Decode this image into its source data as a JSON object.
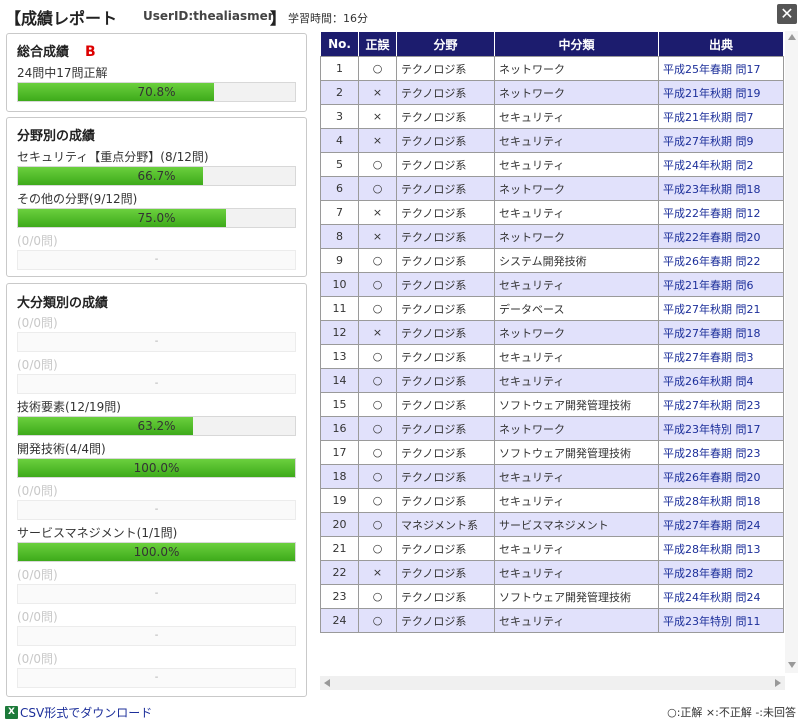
{
  "header": {
    "title": "【成績レポート",
    "user_id": "UserID:thealiasmen",
    "bracket_close": "】",
    "study_time": "学習時間：16分",
    "close_glyph": "✕"
  },
  "overall": {
    "heading": "総合成績",
    "grade": "B",
    "summary": "24問中17問正解",
    "percent": 70.8,
    "percent_label": "70.8%"
  },
  "field": {
    "heading": "分野別の成績",
    "items": [
      {
        "label": "セキュリティ【重点分野】(8/12問)",
        "percent": 66.7,
        "percent_label": "66.7%",
        "empty": false
      },
      {
        "label": "その他の分野(9/12問)",
        "percent": 75.0,
        "percent_label": "75.0%",
        "empty": false
      },
      {
        "label": "(0/0問)",
        "percent": 0,
        "percent_label": "-",
        "empty": true
      }
    ]
  },
  "major": {
    "heading": "大分類別の成績",
    "items": [
      {
        "label": "(0/0問)",
        "percent": 0,
        "percent_label": "-",
        "empty": true
      },
      {
        "label": "(0/0問)",
        "percent": 0,
        "percent_label": "-",
        "empty": true
      },
      {
        "label": "技術要素(12/19問)",
        "percent": 63.2,
        "percent_label": "63.2%",
        "empty": false
      },
      {
        "label": "開発技術(4/4問)",
        "percent": 100.0,
        "percent_label": "100.0%",
        "empty": false
      },
      {
        "label": "(0/0問)",
        "percent": 0,
        "percent_label": "-",
        "empty": true
      },
      {
        "label": "サービスマネジメント(1/1問)",
        "percent": 100.0,
        "percent_label": "100.0%",
        "empty": false
      },
      {
        "label": "(0/0問)",
        "percent": 0,
        "percent_label": "-",
        "empty": true
      },
      {
        "label": "(0/0問)",
        "percent": 0,
        "percent_label": "-",
        "empty": true
      },
      {
        "label": "(0/0問)",
        "percent": 0,
        "percent_label": "-",
        "empty": true
      }
    ]
  },
  "table": {
    "headers": [
      "No.",
      "正誤",
      "分野",
      "中分類",
      "出典"
    ],
    "rows": [
      {
        "no": "1",
        "mark": "○",
        "field": "テクノロジ系",
        "category": "ネットワーク",
        "source": "平成25年春期 問17"
      },
      {
        "no": "2",
        "mark": "×",
        "field": "テクノロジ系",
        "category": "ネットワーク",
        "source": "平成21年秋期 問19"
      },
      {
        "no": "3",
        "mark": "×",
        "field": "テクノロジ系",
        "category": "セキュリティ",
        "source": "平成21年秋期 問7"
      },
      {
        "no": "4",
        "mark": "×",
        "field": "テクノロジ系",
        "category": "セキュリティ",
        "source": "平成27年秋期 問9"
      },
      {
        "no": "5",
        "mark": "○",
        "field": "テクノロジ系",
        "category": "セキュリティ",
        "source": "平成24年秋期 問2"
      },
      {
        "no": "6",
        "mark": "○",
        "field": "テクノロジ系",
        "category": "ネットワーク",
        "source": "平成23年秋期 問18"
      },
      {
        "no": "7",
        "mark": "×",
        "field": "テクノロジ系",
        "category": "セキュリティ",
        "source": "平成22年春期 問12"
      },
      {
        "no": "8",
        "mark": "×",
        "field": "テクノロジ系",
        "category": "ネットワーク",
        "source": "平成22年春期 問20"
      },
      {
        "no": "9",
        "mark": "○",
        "field": "テクノロジ系",
        "category": "システム開発技術",
        "source": "平成26年春期 問22"
      },
      {
        "no": "10",
        "mark": "○",
        "field": "テクノロジ系",
        "category": "セキュリティ",
        "source": "平成21年春期 問6"
      },
      {
        "no": "11",
        "mark": "○",
        "field": "テクノロジ系",
        "category": "データベース",
        "source": "平成27年秋期 問21"
      },
      {
        "no": "12",
        "mark": "×",
        "field": "テクノロジ系",
        "category": "ネットワーク",
        "source": "平成27年春期 問18"
      },
      {
        "no": "13",
        "mark": "○",
        "field": "テクノロジ系",
        "category": "セキュリティ",
        "source": "平成27年春期 問3"
      },
      {
        "no": "14",
        "mark": "○",
        "field": "テクノロジ系",
        "category": "セキュリティ",
        "source": "平成26年秋期 問4"
      },
      {
        "no": "15",
        "mark": "○",
        "field": "テクノロジ系",
        "category": "ソフトウェア開発管理技術",
        "source": "平成27年秋期 問23"
      },
      {
        "no": "16",
        "mark": "○",
        "field": "テクノロジ系",
        "category": "ネットワーク",
        "source": "平成23年特別 問17"
      },
      {
        "no": "17",
        "mark": "○",
        "field": "テクノロジ系",
        "category": "ソフトウェア開発管理技術",
        "source": "平成28年春期 問23"
      },
      {
        "no": "18",
        "mark": "○",
        "field": "テクノロジ系",
        "category": "セキュリティ",
        "source": "平成26年春期 問20"
      },
      {
        "no": "19",
        "mark": "○",
        "field": "テクノロジ系",
        "category": "セキュリティ",
        "source": "平成28年秋期 問18"
      },
      {
        "no": "20",
        "mark": "○",
        "field": "マネジメント系",
        "category": "サービスマネジメント",
        "source": "平成27年春期 問24"
      },
      {
        "no": "21",
        "mark": "○",
        "field": "テクノロジ系",
        "category": "セキュリティ",
        "source": "平成28年秋期 問13"
      },
      {
        "no": "22",
        "mark": "×",
        "field": "テクノロジ系",
        "category": "セキュリティ",
        "source": "平成28年春期 問2"
      },
      {
        "no": "23",
        "mark": "○",
        "field": "テクノロジ系",
        "category": "ソフトウェア開発管理技術",
        "source": "平成24年秋期 問24"
      },
      {
        "no": "24",
        "mark": "○",
        "field": "テクノロジ系",
        "category": "セキュリティ",
        "source": "平成23年特別 問11"
      }
    ]
  },
  "footer": {
    "csv_icon": "X",
    "csv_label": "CSV形式でダウンロード",
    "legend": "○:正解 ×:不正解 -:未回答"
  }
}
